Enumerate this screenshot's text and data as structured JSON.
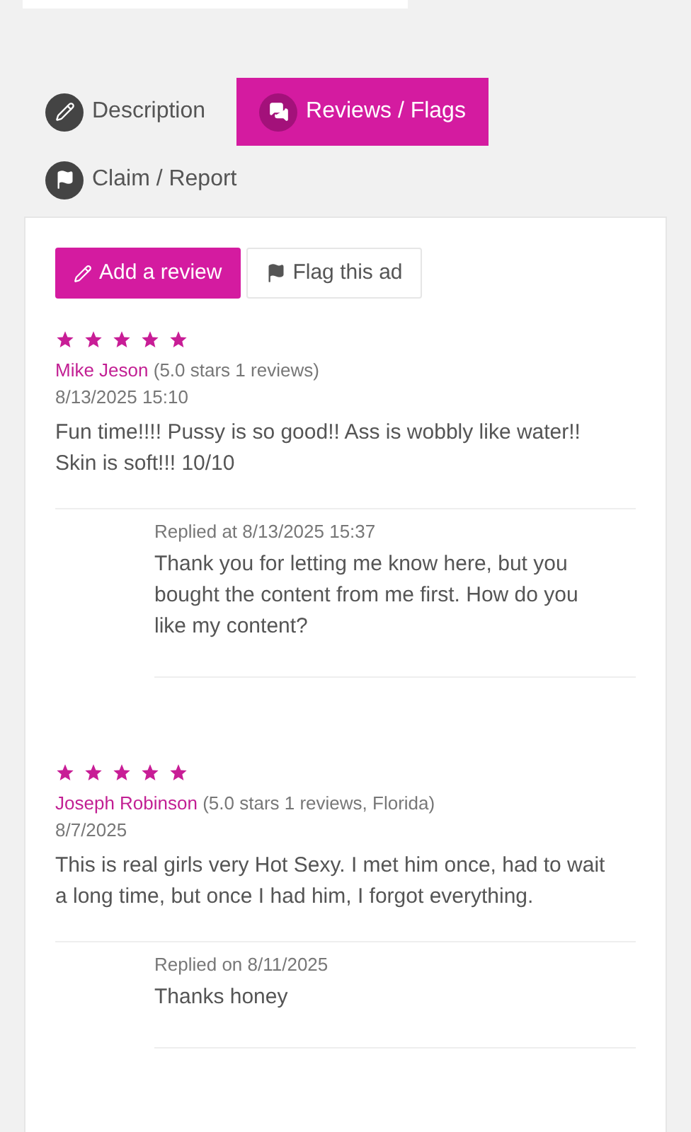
{
  "tabs": [
    {
      "label": "Description",
      "kind": "pencil",
      "selected": false
    },
    {
      "label": "Reviews / Flags",
      "kind": "comments",
      "selected": true
    },
    {
      "label": "Claim / Report",
      "kind": "flag",
      "selected": false
    }
  ],
  "actions": [
    {
      "label": "Add a review",
      "kind": "primary"
    },
    {
      "label": "Flag this ad",
      "kind": "secondary"
    }
  ],
  "reviews": [
    {
      "stars": 5,
      "author": "Mike Jeson",
      "meta": "(5.0 stars 1 reviews)",
      "date": "8/13/2025 15:10",
      "text": "Fun time!!!! Pussy is so good!! Ass is wobbly like water!! Skin is soft!!! 10/10",
      "reply": {
        "label": "Replied at 8/13/2025 15:37",
        "text": "Thank you for letting me know here, but you bought the content from me first. How do you like my content?"
      }
    },
    {
      "stars": 5,
      "author": "Joseph Robinson",
      "meta": "(5.0 stars 1 reviews, Florida)",
      "date": "8/7/2025",
      "text": "This is real girls very Hot Sexy. I met him once, had to wait a long time, but once I had him, I forgot everything.",
      "reply": {
        "label": "Replied on 8/11/2025",
        "text": "Thanks honey"
      }
    }
  ]
}
